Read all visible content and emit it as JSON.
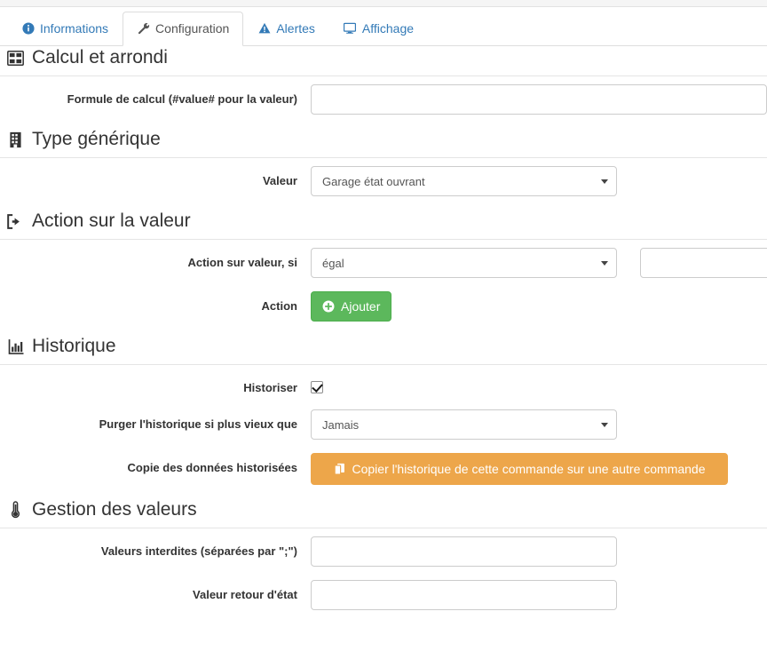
{
  "tabs": [
    {
      "label": "Informations",
      "icon": "info-circle-icon",
      "active": false
    },
    {
      "label": "Configuration",
      "icon": "wrench-icon",
      "active": true
    },
    {
      "label": "Alertes",
      "icon": "warning-triangle-icon",
      "active": false
    },
    {
      "label": "Affichage",
      "icon": "desktop-icon",
      "active": false
    }
  ],
  "sections": {
    "calcul": {
      "title": "Calcul et arrondi",
      "icon": "table-icon",
      "formula_label": "Formule de calcul (#value# pour la valeur)",
      "formula_value": "",
      "formula_placeholder": ""
    },
    "type_generique": {
      "title": "Type générique",
      "icon": "building-icon",
      "valeur_label": "Valeur",
      "valeur_selected": "Garage état ouvrant",
      "valeur_options": [
        "Garage état ouvrant"
      ]
    },
    "action": {
      "title": "Action sur la valeur",
      "icon": "sign-out-icon",
      "condition_label": "Action sur valeur, si",
      "condition_selected": "égal",
      "condition_options": [
        "égal"
      ],
      "condition_value": "",
      "action_label": "Action",
      "add_button_label": "Ajouter",
      "add_button_icon": "plus-circle-icon"
    },
    "historique": {
      "title": "Historique",
      "icon": "bar-chart-icon",
      "historiser_label": "Historiser",
      "historiser_checked": true,
      "purge_label": "Purger l'historique si plus vieux que",
      "purge_selected": "Jamais",
      "purge_options": [
        "Jamais"
      ],
      "copie_label": "Copie des données historisées",
      "copie_button_label": "Copier l'historique de cette commande sur une autre commande",
      "copie_button_icon": "copy-icon"
    },
    "gestion": {
      "title": "Gestion des valeurs",
      "icon": "thermometer-icon",
      "interdites_label": "Valeurs interdites (séparées par \";\")",
      "interdites_value": "",
      "retour_label": "Valeur retour d'état",
      "retour_value": ""
    }
  },
  "colors": {
    "link_blue": "#337ab7",
    "success_green": "#5cb85c",
    "warning_orange": "#eda64a",
    "text_dark": "#333333",
    "border_gray": "#cccccc"
  }
}
